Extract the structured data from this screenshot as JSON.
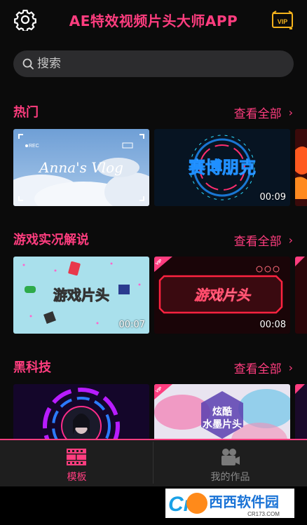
{
  "app": {
    "title": "AE特效视频片头大师APP"
  },
  "icons": {
    "settings": "gear-icon",
    "vip": "vip-icon",
    "search": "search-icon"
  },
  "search": {
    "placeholder": "搜索",
    "value": ""
  },
  "sections": [
    {
      "title": "热门",
      "more": "查看全部",
      "cards": [
        {
          "name": "Anna's Vlog",
          "duration": "",
          "vip": false
        },
        {
          "name": "赛博朋克",
          "duration": "00:09",
          "vip": false
        }
      ]
    },
    {
      "title": "游戏实况解说",
      "more": "查看全部",
      "cards": [
        {
          "name": "游戏片头",
          "duration": "00:07",
          "vip": false
        },
        {
          "name": "游戏片头",
          "duration": "00:08",
          "vip": true
        }
      ]
    },
    {
      "title": "黑科技",
      "more": "查看全部",
      "cards": [
        {
          "name": "",
          "duration": "",
          "vip": false
        },
        {
          "name": "炫酷水墨片头",
          "duration": "",
          "vip": true
        }
      ]
    }
  ],
  "tabs": [
    {
      "label": "模板",
      "active": true
    },
    {
      "label": "我的作品",
      "active": false
    }
  ],
  "vip_tag_text": "VIP",
  "vlog_card": {
    "rec": "REC"
  },
  "ink_card": {
    "line1": "炫酷",
    "line2": "水墨片头"
  },
  "watermark": {
    "text": "西西软件园",
    "sub": "CR173.COM",
    "logo": "Cr"
  },
  "colors": {
    "accent": "#ff3d7f",
    "background": "#0b0b0b",
    "tabbar": "#1e1e1e"
  }
}
